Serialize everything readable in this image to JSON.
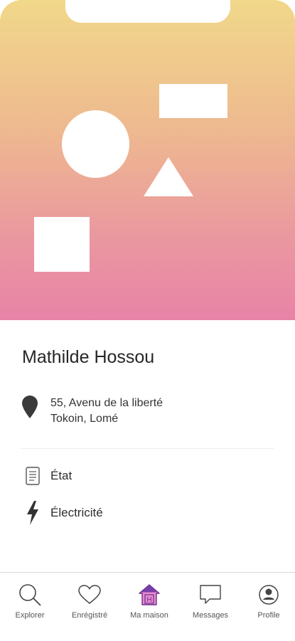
{
  "profile": {
    "name": "Mathilde Hossou",
    "address_line1": "55, Avenu de la liberté",
    "address_line2": "Tokoin, Lomé"
  },
  "details": {
    "state_label": "État",
    "electricity_label": "Électricité"
  },
  "bottom_nav": {
    "explorer": "Explorer",
    "saved": "Enrégistré",
    "home": "Ma maison",
    "messages": "Messages",
    "profile": "Profile"
  },
  "colors": {
    "gradient_top": "#f1d88a",
    "gradient_bottom": "#e883a7",
    "accent": "#8e3fb5",
    "home_icon_fill": "#e98bd0"
  },
  "icons": {
    "address": "map-pin-icon",
    "state": "document-icon",
    "electricity": "lightning-icon",
    "explorer": "search-icon",
    "saved": "heart-icon",
    "home": "house-icon",
    "messages": "chat-bubble-icon",
    "profile": "user-circle-icon"
  }
}
